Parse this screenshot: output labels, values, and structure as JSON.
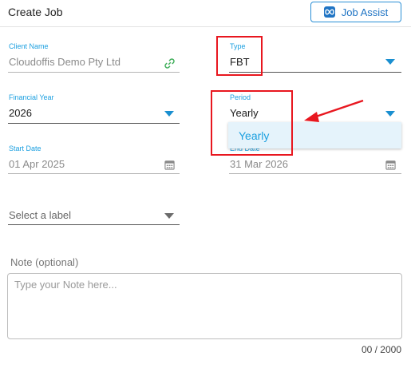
{
  "header": {
    "title": "Create Job",
    "assist_label": "Job Assist"
  },
  "form": {
    "client_name": {
      "label": "Client Name",
      "value": "Cloudoffis Demo Pty Ltd"
    },
    "type": {
      "label": "Type",
      "value": "FBT"
    },
    "financial_year": {
      "label": "Financial Year",
      "value": "2026"
    },
    "period": {
      "label": "Period",
      "value": "Yearly",
      "options": [
        "Yearly"
      ]
    },
    "start_date": {
      "label": "Start Date",
      "value": "01 Apr 2025"
    },
    "end_date": {
      "label": "End Date",
      "value": "31 Mar 2026"
    },
    "label_select": {
      "placeholder": "Select a label"
    },
    "note": {
      "label": "Note (optional)",
      "placeholder": "Type your Note here...",
      "counter": "00 / 2000"
    }
  },
  "colors": {
    "accent": "#1ca0e0",
    "annotation": "#e8171f",
    "link_icon": "#3fae5a"
  }
}
